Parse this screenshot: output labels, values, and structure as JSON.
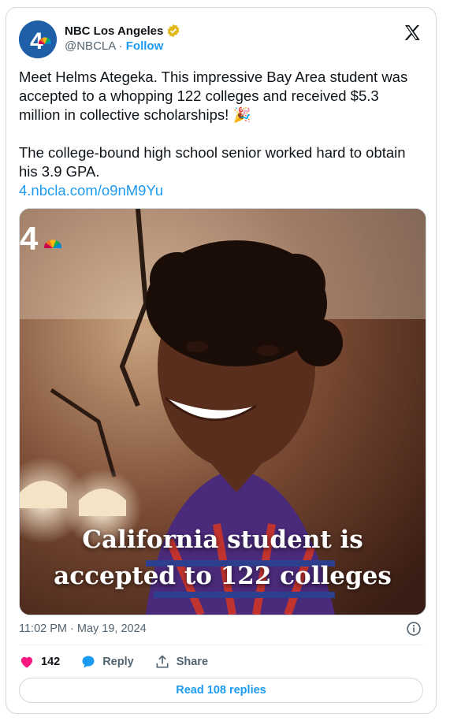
{
  "account": {
    "name": "NBC Los Angeles",
    "handle": "@NBCLA",
    "separator": "·",
    "follow_label": "Follow",
    "avatar_text": "4",
    "verified": "gold-verified-badge"
  },
  "tweet": {
    "text_line1": "Meet Helms Ategeka. This impressive Bay Area student was accepted to a whopping 122 colleges and received $5.3 million in collective scholarships! 🎉",
    "text_line2": "The college-bound high school senior worked hard to obtain his 3.9 GPA.",
    "link": "4.nbcla.com/o9nM9Yu"
  },
  "media": {
    "watermark": "4",
    "caption_line1": "California student is",
    "caption_line2": "accepted to 122 colleges"
  },
  "meta": {
    "timestamp": "11:02 PM · May 19, 2024"
  },
  "actions": {
    "likes": "142",
    "reply_label": "Reply",
    "share_label": "Share"
  },
  "read_replies": "Read 108 replies",
  "colors": {
    "accent": "#1d9bf0",
    "like": "#f91880",
    "text": "#0f1419",
    "muted": "#536471"
  }
}
